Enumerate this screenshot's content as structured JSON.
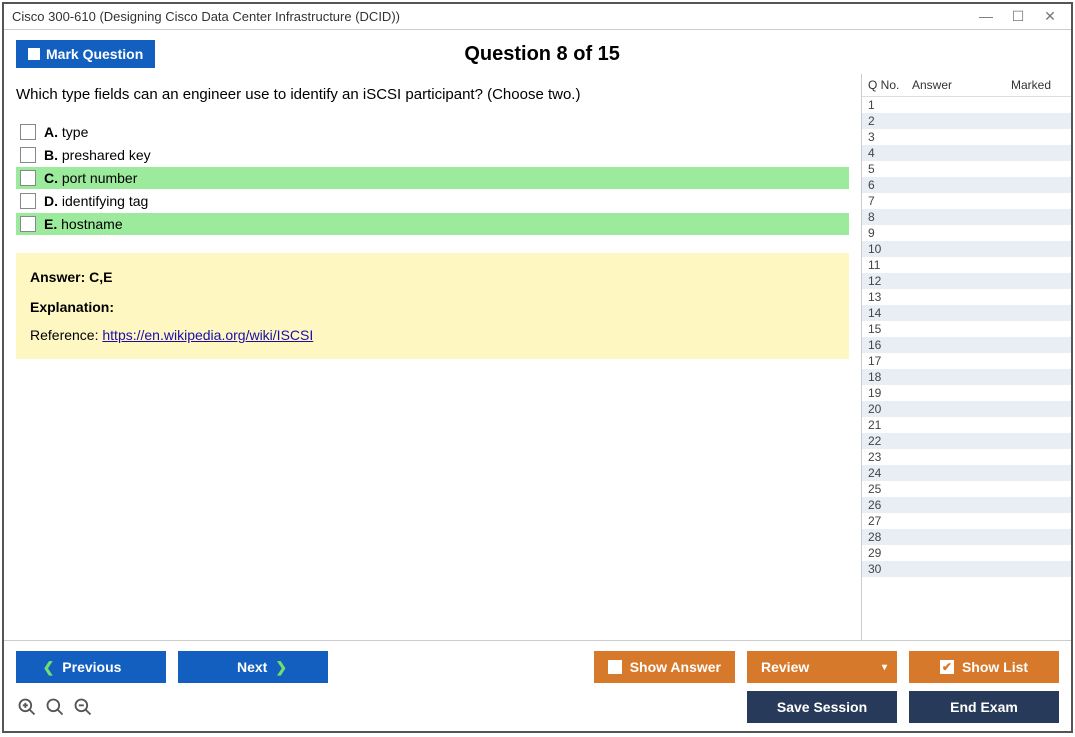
{
  "window": {
    "title": "Cisco 300-610 (Designing Cisco Data Center Infrastructure (DCID))"
  },
  "header": {
    "mark_label": "Mark Question",
    "question_title": "Question 8 of 15"
  },
  "question": {
    "text": "Which type fields can an engineer use to identify an iSCSI participant? (Choose two.)",
    "choices": [
      {
        "letter": "A.",
        "text": "type",
        "correct": false
      },
      {
        "letter": "B.",
        "text": "preshared key",
        "correct": false
      },
      {
        "letter": "C.",
        "text": "port number",
        "correct": true
      },
      {
        "letter": "D.",
        "text": "identifying tag",
        "correct": false
      },
      {
        "letter": "E.",
        "text": "hostname",
        "correct": true
      }
    ]
  },
  "explanation": {
    "answer_label": "Answer: C,E",
    "explanation_label": "Explanation:",
    "ref_prefix": "Reference: ",
    "ref_link_text": "https://en.wikipedia.org/wiki/ISCSI",
    "ref_link_href": "https://en.wikipedia.org/wiki/ISCSI"
  },
  "sidebar": {
    "col_qno": "Q No.",
    "col_answer": "Answer",
    "col_marked": "Marked",
    "rows": [
      1,
      2,
      3,
      4,
      5,
      6,
      7,
      8,
      9,
      10,
      11,
      12,
      13,
      14,
      15,
      16,
      17,
      18,
      19,
      20,
      21,
      22,
      23,
      24,
      25,
      26,
      27,
      28,
      29,
      30
    ]
  },
  "footer": {
    "previous": "Previous",
    "next": "Next",
    "show_answer": "Show Answer",
    "review": "Review",
    "show_list": "Show List",
    "save_session": "Save Session",
    "end_exam": "End Exam"
  }
}
